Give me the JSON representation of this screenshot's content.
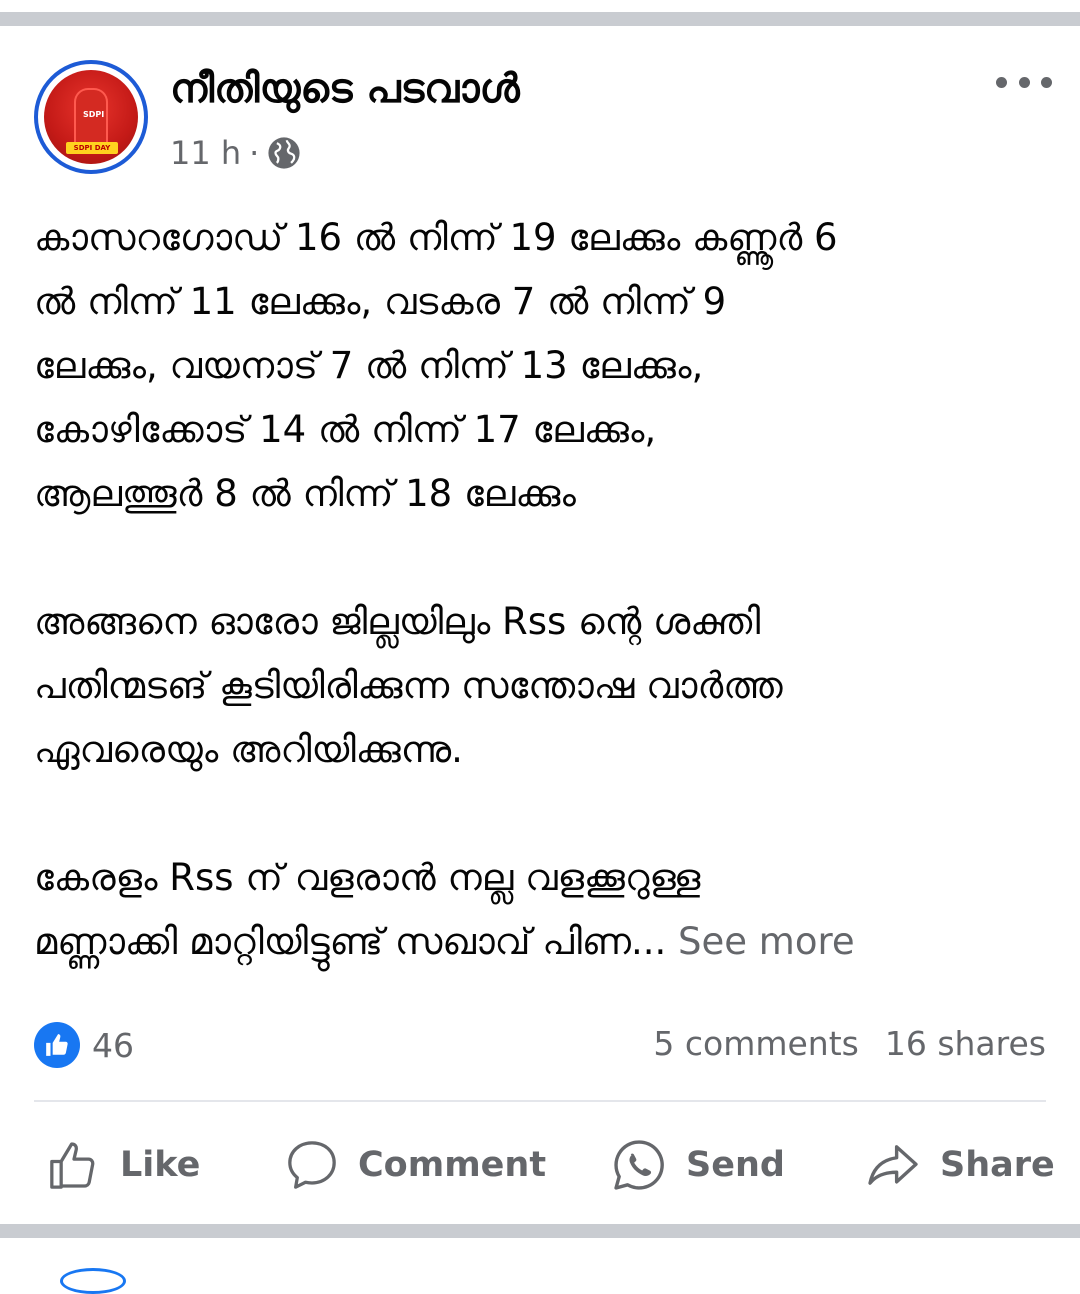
{
  "post": {
    "page_name": "നീതിയുടെ പടവാൾ",
    "time": "11 h",
    "separator": "·",
    "privacy_icon": "globe-icon",
    "avatar_caption": "SDPI",
    "avatar_badge": "SDPI DAY",
    "lines": [
      "കാസറഗോഡ് 16 ൽ നിന്ന് 19 ലേക്കും കണ്ണൂർ 6",
      "ൽ നിന്ന് 11 ലേക്കും, വടകര 7 ൽ നിന്ന് 9",
      "ലേക്കും, വയനാട് 7 ൽ നിന്ന് 13 ലേക്കും,",
      "കോഴിക്കോട് 14 ൽ നിന്ന് 17 ലേക്കും,",
      "ആലത്തൂർ  8 ൽ നിന്ന് 18 ലേക്കും",
      "അങ്ങനെ ഓരോ ജില്ലയിലും Rss ന്റെ ശക്തി",
      "പതിന്മടങ് കൂടിയിരിക്കുന്ന സന്തോഷ വാർത്ത",
      "ഏവരെയും അറിയിക്കുന്നു.",
      "കേരളം Rss ന് വളരാൻ നല്ല വളക്കൂറുള്ള",
      "മണ്ണാക്കി മാറ്റിയിട്ടുണ്ട് സഖാവ് പിണ..."
    ],
    "see_more": " See more"
  },
  "engagement": {
    "reaction_icon": "like-icon",
    "reactions_count": "46",
    "comments": "5 comments",
    "shares": "16 shares"
  },
  "actions": {
    "like": "Like",
    "comment": "Comment",
    "send": "Send",
    "share": "Share"
  },
  "colors": {
    "accent": "#1877f2",
    "secondary_text": "#65676b",
    "separator": "#c9ccd1"
  }
}
